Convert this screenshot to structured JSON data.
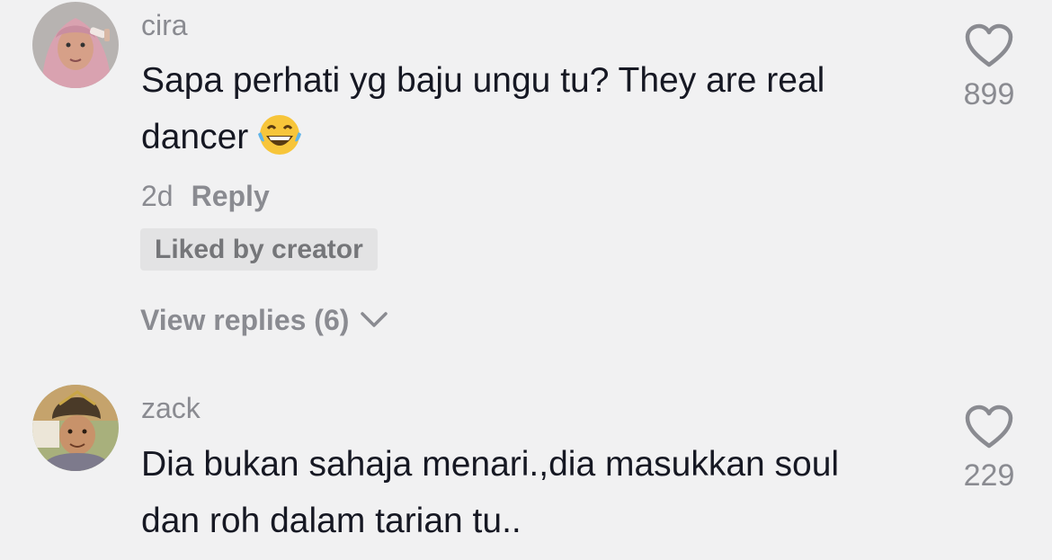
{
  "comments": [
    {
      "username": "cira",
      "text": "Sapa perhati yg baju ungu tu? They are real dancer",
      "emoji": "😂",
      "age": "2d",
      "reply_label": "Reply",
      "badge": "Liked by creator",
      "view_replies": "View replies (6)",
      "likes": "899"
    },
    {
      "username": "zack",
      "text": "Dia bukan sahaja menari.,dia masukkan soul dan roh dalam tarian tu..",
      "likes": "229"
    }
  ],
  "icons": {
    "like": "heart-outline-icon",
    "expand": "chevron-down-icon",
    "emoji": "face-with-tears-of-joy"
  },
  "colors": {
    "background": "#f1f1f2",
    "text": "#161823",
    "secondary": "#8a8b91",
    "badge_bg": "#e3e3e4"
  }
}
